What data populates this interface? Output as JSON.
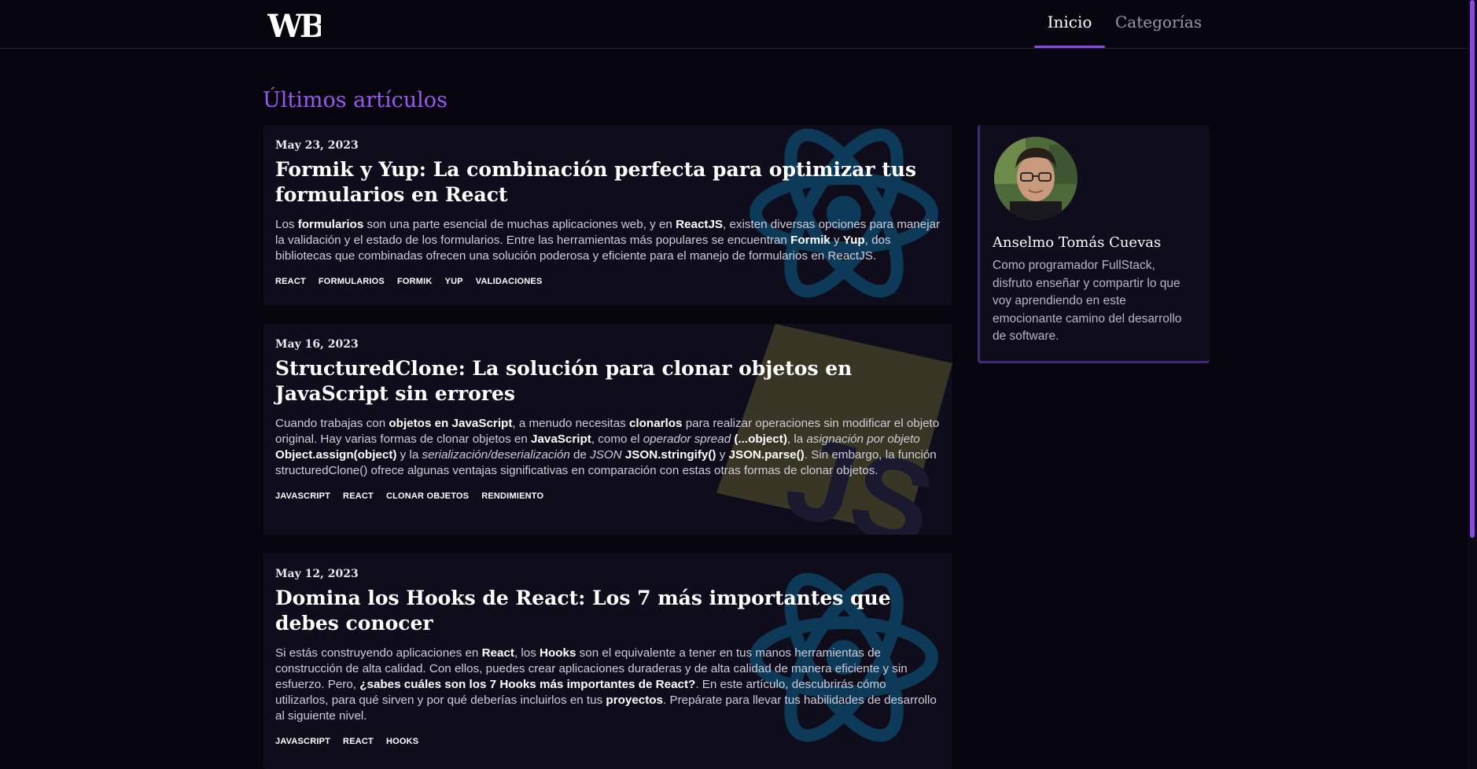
{
  "header": {
    "logo_text": "WB",
    "nav": [
      {
        "label": "Inicio",
        "active": true
      },
      {
        "label": "Categorías",
        "active": false
      }
    ]
  },
  "main": {
    "title": "Últimos artículos"
  },
  "articles": [
    {
      "date": "May 23, 2023",
      "title": "Formik y Yup: La combinación perfecta para optimizar tus formularios en React",
      "excerpt": [
        {
          "t": "Los "
        },
        {
          "t": "formularios",
          "b": true
        },
        {
          "t": " son una parte esencial de muchas aplicaciones web, y en "
        },
        {
          "t": "ReactJS",
          "b": true
        },
        {
          "t": ", existen diversas opciones para manejar la validación y el estado de los formularios. Entre las herramientas más populares se encuentran "
        },
        {
          "t": "Formik",
          "b": true
        },
        {
          "t": " y "
        },
        {
          "t": "Yup",
          "b": true
        },
        {
          "t": ", dos bibliotecas que combinadas ofrecen una solución poderosa y eficiente para el manejo de formularios en ReactJS."
        }
      ],
      "tags": [
        "REACT",
        "FORMULARIOS",
        "FORMIK",
        "YUP",
        "VALIDACIONES"
      ],
      "bg_icon": "react-logo-icon"
    },
    {
      "date": "May 16, 2023",
      "title": "StructuredClone: La solución para clonar objetos en JavaScript sin errores",
      "excerpt": [
        {
          "t": "Cuando trabajas con "
        },
        {
          "t": "objetos en JavaScript",
          "b": true
        },
        {
          "t": ", a menudo necesitas "
        },
        {
          "t": "clonarlos",
          "b": true
        },
        {
          "t": " para realizar operaciones sin modificar el objeto original. Hay varias formas de clonar objetos en "
        },
        {
          "t": "JavaScript",
          "b": true
        },
        {
          "t": ", como el "
        },
        {
          "t": "operador spread",
          "i": true
        },
        {
          "t": " "
        },
        {
          "t": "(...object)",
          "b": true
        },
        {
          "t": ", la "
        },
        {
          "t": "asignación por objeto",
          "i": true
        },
        {
          "t": " "
        },
        {
          "t": "Object.assign(object)",
          "b": true
        },
        {
          "t": " y la "
        },
        {
          "t": "serialización/deserialización",
          "i": true
        },
        {
          "t": " de "
        },
        {
          "t": "JSON",
          "i": true
        },
        {
          "t": " "
        },
        {
          "t": "JSON.stringify()",
          "b": true
        },
        {
          "t": " y "
        },
        {
          "t": "JSON.parse()",
          "b": true
        },
        {
          "t": ". Sin embargo, la función structuredClone() ofrece algunas ventajas significativas en comparación con estas otras formas de clonar objetos."
        }
      ],
      "tags": [
        "JAVASCRIPT",
        "REACT",
        "CLONAR OBJETOS",
        "RENDIMIENTO"
      ],
      "bg_icon": "javascript-logo-icon"
    },
    {
      "date": "May 12, 2023",
      "title": "Domina los Hooks de React: Los 7 más importantes que debes conocer",
      "excerpt": [
        {
          "t": "Si estás construyendo aplicaciones en "
        },
        {
          "t": "React",
          "b": true
        },
        {
          "t": ", los "
        },
        {
          "t": "Hooks",
          "b": true
        },
        {
          "t": " son el equivalente a tener en tus manos herramientas de construcción de alta calidad. Con ellos, puedes crear aplicaciones duraderas y de alta calidad de manera eficiente y sin esfuerzo. Pero, "
        },
        {
          "t": "¿sabes cuáles son los 7 Hooks más importantes de React?",
          "b": true
        },
        {
          "t": ". En este artículo, descubrirás cómo utilizarlos, para qué sirven y por qué deberías incluirlos en tus "
        },
        {
          "t": "proyectos",
          "b": true
        },
        {
          "t": ". Prepárate para llevar tus habilidades de desarrollo al siguiente nivel."
        }
      ],
      "tags": [
        "JAVASCRIPT",
        "REACT",
        "HOOKS"
      ],
      "bg_icon": "react-logo-icon"
    }
  ],
  "author": {
    "name": "Anselmo Tomás Cuevas",
    "bio": "Como programador FullStack, disfruto enseñar y compartir lo que voy aprendiendo en este emocionante camino del desarrollo de software."
  },
  "colors": {
    "accent": "#8a46e6",
    "background": "#07060f",
    "card": "#0f0d1c"
  }
}
